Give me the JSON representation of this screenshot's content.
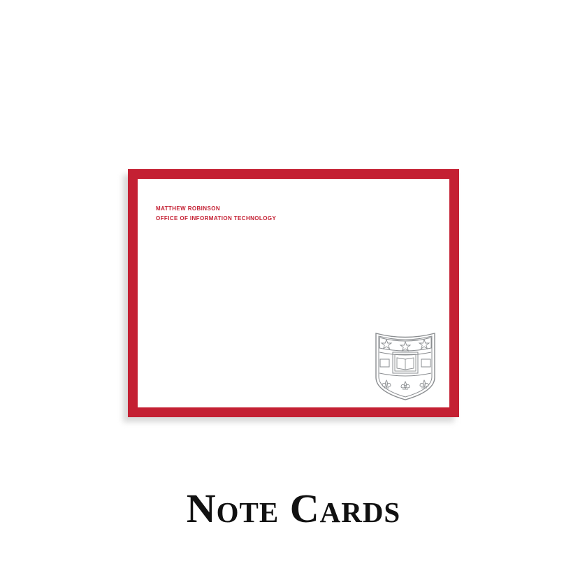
{
  "card": {
    "name_line": "MATTHEW ROBINSON",
    "department_line": "OFFICE OF INFORMATION TECHNOLOGY",
    "logo": "shield-crest-icon"
  },
  "caption": "Note Cards",
  "colors": {
    "border_red": "#c42033",
    "text_red": "#c42033",
    "crest_gray": "#8a8d90",
    "caption_black": "#111111"
  }
}
